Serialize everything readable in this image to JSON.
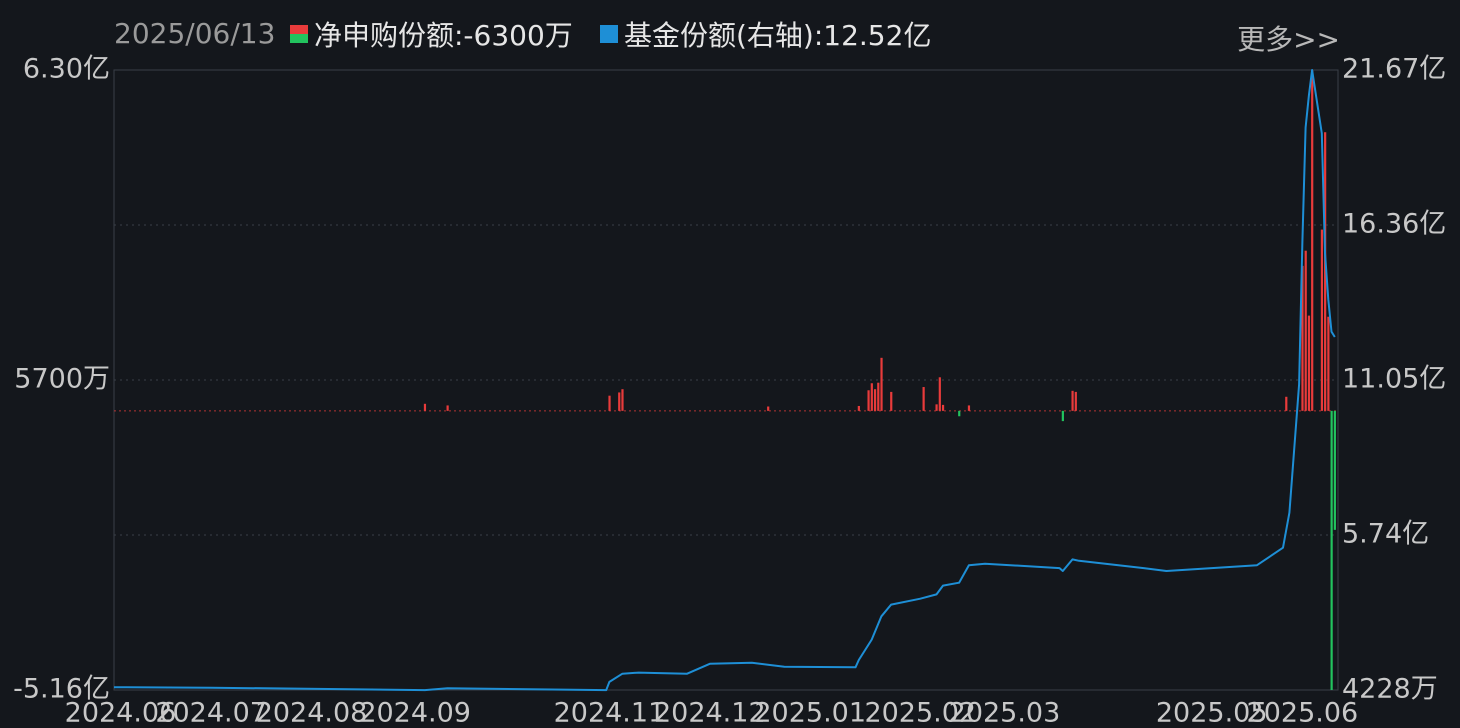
{
  "header": {
    "date": "2025/06/13",
    "legend_net_label": "净申购份额:-6300万",
    "legend_share_label": "基金份额(右轴):12.52亿",
    "more_label": "更多>>"
  },
  "colors": {
    "background": "#14171c",
    "grid": "#3a3f47",
    "positive_bar": "#e83b3b",
    "negative_bar": "#22c35e",
    "share_line": "#1e8fd6"
  },
  "chart_data": {
    "type": "bar",
    "left_axis": {
      "unit": "万",
      "ylim": [
        -51600,
        63000
      ],
      "tick_labels": [
        "6.30亿",
        "5700万",
        "-5.16亿"
      ]
    },
    "right_axis": {
      "unit": "亿",
      "ylim": [
        0.4228,
        21.67
      ],
      "tick_labels": [
        "21.67亿",
        "16.36亿",
        "11.05亿",
        "5.74亿",
        "4228万"
      ]
    },
    "x_tick_labels": [
      "2024.06",
      "2024.07",
      "2024.08",
      "2024.09",
      "2024.11",
      "2024.12",
      "2025.01",
      "2025.02",
      "2025.03",
      "2025.05",
      "2025.06"
    ],
    "x_tick_dates": [
      "2024-06-03",
      "2024-07-01",
      "2024-08-01",
      "2024-09-02",
      "2024-11-01",
      "2024-12-02",
      "2025-01-02",
      "2025-02-05",
      "2025-03-03",
      "2025-05-06",
      "2025-06-03"
    ],
    "x_range": [
      "2024-06-01",
      "2025-06-13"
    ],
    "legend_position": "top-left",
    "grid": true,
    "net_subscription_series": {
      "name": "净申购份额",
      "unit": "万份",
      "dates": [
        "2024-09-05",
        "2024-09-12",
        "2024-11-01",
        "2024-11-04",
        "2024-11-05",
        "2024-12-20",
        "2025-01-17",
        "2025-01-20",
        "2025-01-21",
        "2025-01-22",
        "2025-01-23",
        "2025-01-24",
        "2025-01-27",
        "2025-02-06",
        "2025-02-10",
        "2025-02-11",
        "2025-02-12",
        "2025-02-17",
        "2025-02-20",
        "2025-03-21",
        "2025-03-24",
        "2025-03-25",
        "2025-05-29",
        "2025-06-03",
        "2025-06-04",
        "2025-06-05",
        "2025-06-06",
        "2025-06-09",
        "2025-06-10",
        "2025-06-11",
        "2025-06-12",
        "2025-06-13"
      ],
      "values": [
        1300,
        1000,
        2800,
        3400,
        4000,
        800,
        900,
        3800,
        5100,
        4000,
        5200,
        9800,
        3500,
        4400,
        1200,
        6200,
        1100,
        -1000,
        1000,
        -1900,
        3700,
        3500,
        2600,
        26800,
        29600,
        17600,
        62900,
        33500,
        51500,
        17400,
        -51600,
        -22000
      ]
    },
    "fund_share_series": {
      "name": "基金份额(右轴)",
      "unit": "亿份",
      "dates": [
        "2024-06-01",
        "2024-07-01",
        "2024-09-05",
        "2024-09-12",
        "2024-10-31",
        "2024-11-01",
        "2024-11-05",
        "2024-11-10",
        "2024-11-25",
        "2024-12-02",
        "2024-12-15",
        "2024-12-25",
        "2025-01-16",
        "2025-01-17",
        "2025-01-21",
        "2025-01-24",
        "2025-01-27",
        "2025-02-05",
        "2025-02-10",
        "2025-02-12",
        "2025-02-17",
        "2025-02-20",
        "2025-02-25",
        "2025-03-20",
        "2025-03-21",
        "2025-03-24",
        "2025-03-26",
        "2025-04-15",
        "2025-04-22",
        "2025-05-20",
        "2025-05-28",
        "2025-05-30",
        "2025-06-02",
        "2025-06-03",
        "2025-06-04",
        "2025-06-05",
        "2025-06-06",
        "2025-06-09",
        "2025-06-10",
        "2025-06-11",
        "2025-06-12",
        "2025-06-13"
      ],
      "values": [
        0.52,
        0.5,
        0.42,
        0.48,
        0.42,
        0.7,
        0.98,
        1.02,
        0.98,
        1.32,
        1.36,
        1.22,
        1.2,
        1.45,
        2.15,
        2.95,
        3.35,
        3.55,
        3.7,
        4.0,
        4.1,
        4.7,
        4.75,
        4.6,
        4.5,
        4.9,
        4.85,
        4.6,
        4.5,
        4.7,
        5.3,
        6.5,
        10.9,
        15.8,
        19.7,
        20.8,
        21.67,
        19.5,
        15.4,
        13.8,
        12.7,
        12.52
      ]
    }
  }
}
